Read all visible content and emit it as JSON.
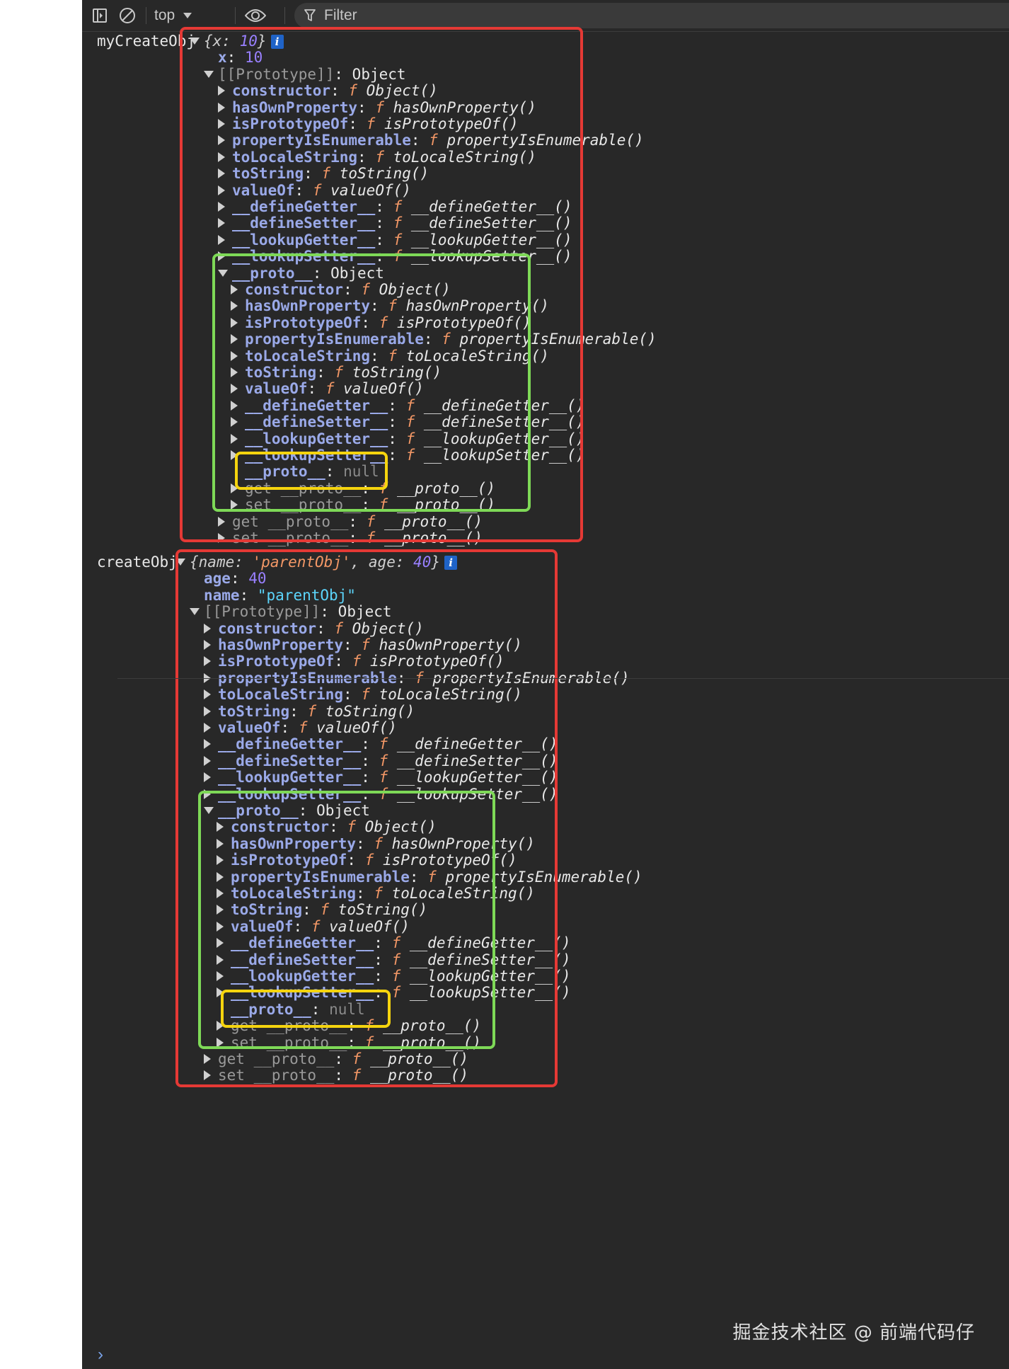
{
  "toolbar": {
    "context": "top",
    "filter_placeholder": "Filter"
  },
  "entries": [
    {
      "label": "myCreateObj",
      "summary_open": "{",
      "summary_parts": [
        {
          "k": "x",
          "v": "10",
          "t": "num"
        }
      ],
      "summary_close": "}",
      "own_props": [
        {
          "k": "x",
          "v": "10",
          "t": "num"
        }
      ],
      "prototype_label": "[[Prototype]]",
      "prototype_value": "Object"
    },
    {
      "label": "createObj",
      "summary_open": "{",
      "summary_parts": [
        {
          "k": "name",
          "v": "'parentObj'",
          "t": "strq"
        },
        {
          "k": "age",
          "v": "40",
          "t": "num"
        }
      ],
      "summary_close": "}",
      "own_props": [
        {
          "k": "age",
          "v": "40",
          "t": "num"
        },
        {
          "k": "name",
          "v": "\"parentObj\"",
          "t": "str"
        }
      ],
      "prototype_label": "[[Prototype]]",
      "prototype_value": "Object"
    }
  ],
  "object_methods": [
    {
      "k": "constructor",
      "fn": "Object()"
    },
    {
      "k": "hasOwnProperty",
      "fn": "hasOwnProperty()"
    },
    {
      "k": "isPrototypeOf",
      "fn": "isPrototypeOf()"
    },
    {
      "k": "propertyIsEnumerable",
      "fn": "propertyIsEnumerable()"
    },
    {
      "k": "toLocaleString",
      "fn": "toLocaleString()"
    },
    {
      "k": "toString",
      "fn": "toString()"
    },
    {
      "k": "valueOf",
      "fn": "valueOf()"
    },
    {
      "k": "__defineGetter__",
      "fn": "__defineGetter__()"
    },
    {
      "k": "__defineSetter__",
      "fn": "__defineSetter__()"
    },
    {
      "k": "__lookupGetter__",
      "fn": "__lookupGetter__()"
    },
    {
      "k": "__lookupSetter__",
      "fn": "__lookupSetter__()"
    }
  ],
  "proto_label": "__proto__",
  "proto_value": "Object",
  "proto_null_value": "null",
  "getter_label": "get __proto__",
  "setter_label": "set __proto__",
  "accessor_fn": "__proto__()",
  "f_glyph": "f",
  "info_glyph": "i",
  "colon": ":",
  "watermark": "掘金技术社区 @ 前端代码仔",
  "prompt_glyph": "›",
  "icons": {
    "sidebar": "sidebar-toggle-icon",
    "clear": "clear-console-icon",
    "context": "chevron-down-icon",
    "eye": "live-expression-eye-icon",
    "filter": "filter-funnel-icon"
  },
  "colors": {
    "highlight_outer": "#e53935",
    "highlight_proto": "#7ed957",
    "highlight_null": "#f5d40e"
  }
}
